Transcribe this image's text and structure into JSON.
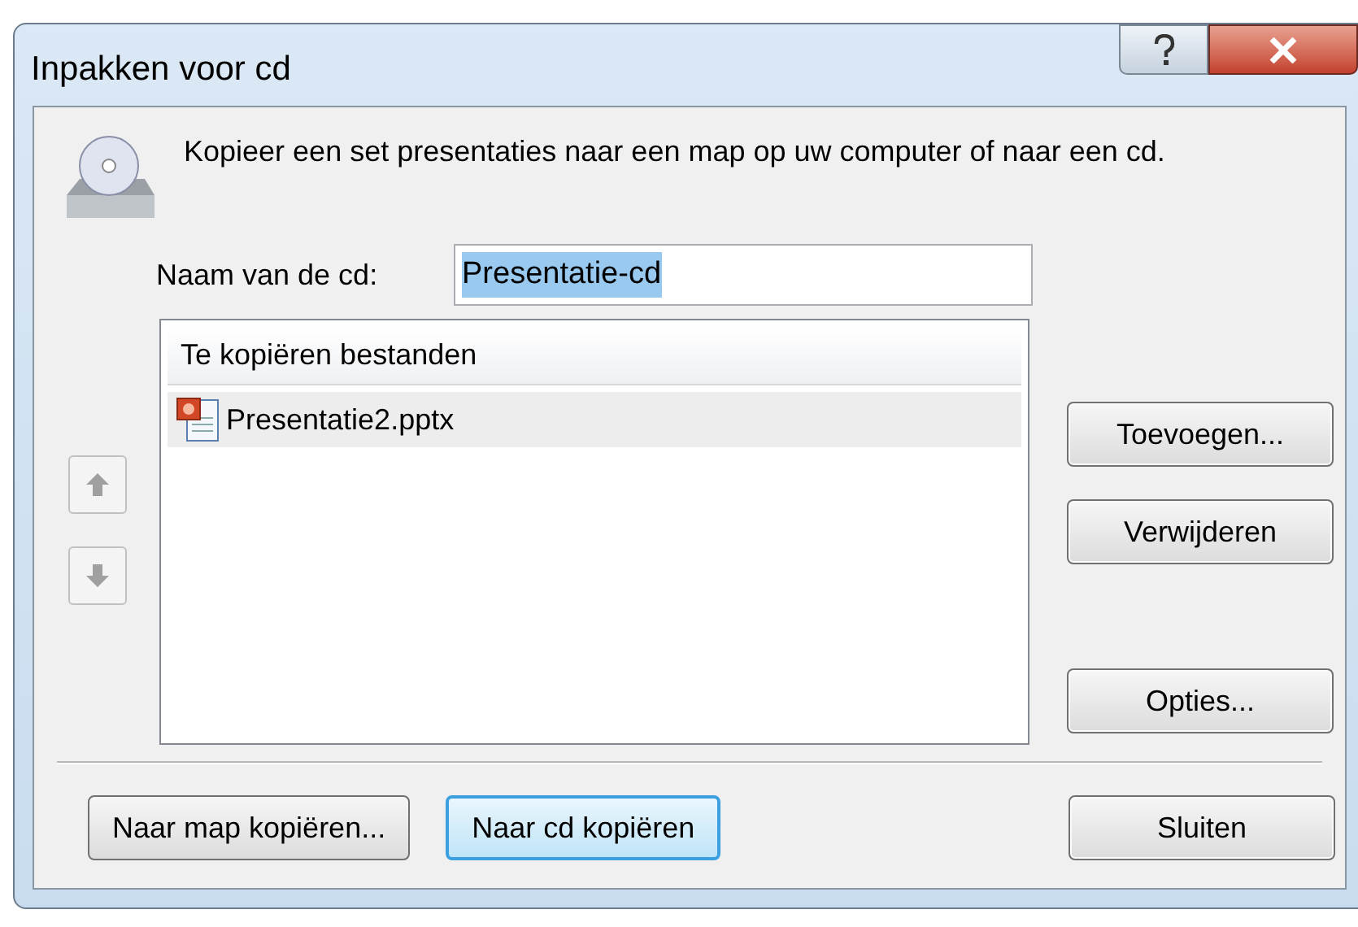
{
  "window": {
    "title": "Inpakken voor cd"
  },
  "description": "Kopieer een set presentaties naar een map op uw computer of naar een cd.",
  "cd_name": {
    "label": "Naam van de cd:",
    "value": "Presentatie-cd",
    "text_selected": true
  },
  "file_list": {
    "header": "Te kopiëren bestanden",
    "items": [
      {
        "name": "Presentatie2.pptx",
        "selected": true
      }
    ]
  },
  "side_buttons": [
    "Toevoegen...",
    "Verwijderen",
    "Opties..."
  ],
  "bottom_buttons": [
    {
      "label": "Naar map kopiëren...",
      "default": false
    },
    {
      "label": "Naar cd kopiëren",
      "default": true
    }
  ],
  "close_button": "Sluiten"
}
